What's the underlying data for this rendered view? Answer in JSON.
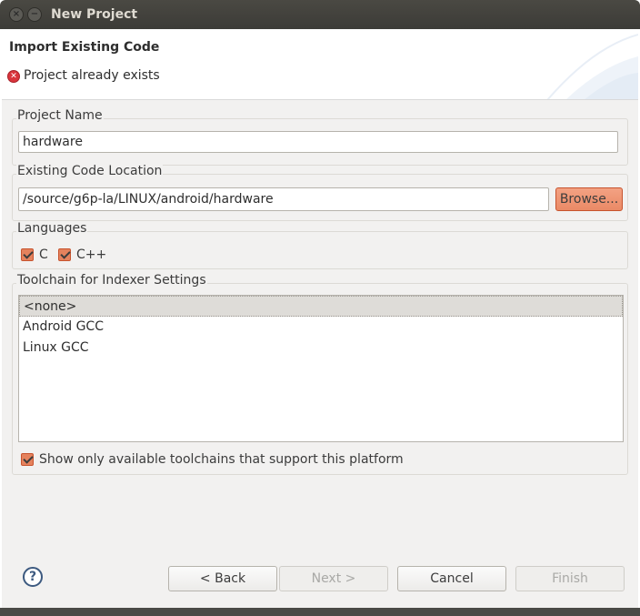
{
  "window": {
    "title": "New Project",
    "close_glyph": "×",
    "minimize_glyph": "−"
  },
  "header": {
    "title": "Import Existing Code",
    "error_message": "Project already exists",
    "error_icon": "error-icon"
  },
  "project_name": {
    "label": "Project Name",
    "value": "hardware"
  },
  "code_location": {
    "label": "Existing Code Location",
    "value": "/source/g6p-la/LINUX/android/hardware",
    "browse_label": "Browse..."
  },
  "languages": {
    "label": "Languages",
    "items": [
      {
        "label": "C",
        "checked": true
      },
      {
        "label": "C++",
        "checked": true
      }
    ]
  },
  "toolchain": {
    "label": "Toolchain for Indexer Settings",
    "items": [
      "<none>",
      "Android GCC",
      "Linux GCC"
    ],
    "selected": "<none>",
    "show_only_label": "Show only available toolchains that support this platform",
    "show_only_checked": true
  },
  "footer": {
    "help_glyph": "?",
    "back_label": "< Back",
    "next_label": "Next >",
    "cancel_label": "Cancel",
    "finish_label": "Finish"
  },
  "colors": {
    "accent": "#e5825d",
    "error": "#d9343c",
    "titlebar": "#3c3b37"
  }
}
